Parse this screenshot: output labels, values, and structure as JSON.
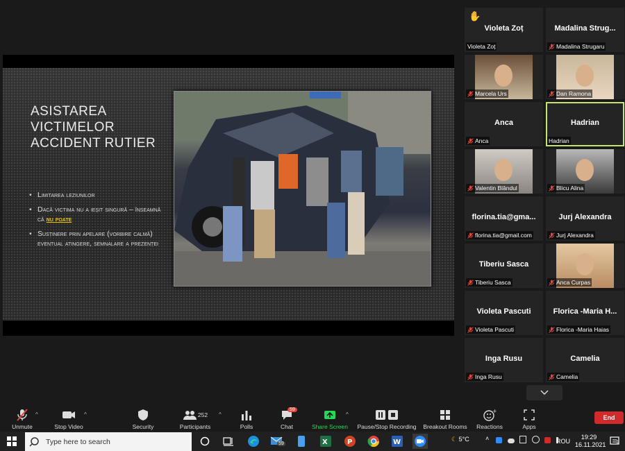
{
  "slide": {
    "title": "ASISTAREA VICTIMELOR ACCIDENT RUTIER",
    "bullet1": "Limitarea leziunilor",
    "bullet2_pre": "Dacă victima nu a ieșit singură – înseamnă că ",
    "bullet2_hl": "nu poate",
    "bullet3": "Susținere prin apelare (vorbire calmă) eventual atingere, semnalare a prezenței"
  },
  "participants": [
    {
      "big": "Violeta Zoț",
      "label": "Violeta Zoț",
      "hand": true,
      "muted": false
    },
    {
      "big": "Madalina  Strug...",
      "label": "Madalina Strugaru",
      "muted": true
    },
    {
      "label": "Marcela Urs",
      "muted": true,
      "video": true
    },
    {
      "label": "Dan Ramona",
      "muted": true,
      "video": true
    },
    {
      "big": "Anca",
      "label": "Anca",
      "muted": true
    },
    {
      "big": "Hadrian",
      "label": "Hadrian",
      "muted": false,
      "active": true
    },
    {
      "label": "Valentin Blândul",
      "muted": true,
      "video": true
    },
    {
      "label": "Blicu Alina",
      "muted": true,
      "video": true
    },
    {
      "big": "florina.tia@gma...",
      "label": "florina.tia@gmail.com",
      "muted": true
    },
    {
      "big": "Jurj Alexandra",
      "label": "Jurj Alexandra",
      "muted": true
    },
    {
      "big": "Tiberiu Sasca",
      "label": "Tiberiu Sasca",
      "muted": true
    },
    {
      "label": "Anca Curpas",
      "muted": true,
      "video": true
    },
    {
      "big": "Violeta Pascuti",
      "label": "Violeta Pascuti",
      "muted": true
    },
    {
      "big": "Florica  -Maria  H...",
      "label": "Florica -Maria Haias",
      "muted": true
    },
    {
      "big": "Inga Rusu",
      "label": "Inga Rusu",
      "muted": true
    },
    {
      "big": "Camelia",
      "label": "Camelia",
      "muted": true
    }
  ],
  "toolbar": {
    "unmute": "Unmute",
    "stop_video": "Stop Video",
    "security": "Security",
    "participants": "Participants",
    "participants_count": "252",
    "polls": "Polls",
    "chat": "Chat",
    "chat_badge": "59",
    "share_screen": "Share Screen",
    "recording": "Pause/Stop Recording",
    "breakout": "Breakout Rooms",
    "reactions": "Reactions",
    "apps": "Apps",
    "end": "End"
  },
  "taskbar": {
    "search_placeholder": "Type here to search",
    "mail_badge": "59",
    "weather": "5°C",
    "language": "ROU",
    "time": "19:29",
    "date": "16.11.2021",
    "notification_count": "1"
  },
  "colors": {
    "active_border": "#c6e66b",
    "end_red": "#d12a2a",
    "share_green": "#23d959",
    "highlight_yellow": "#e9c400",
    "mic_red": "#e0463c"
  }
}
